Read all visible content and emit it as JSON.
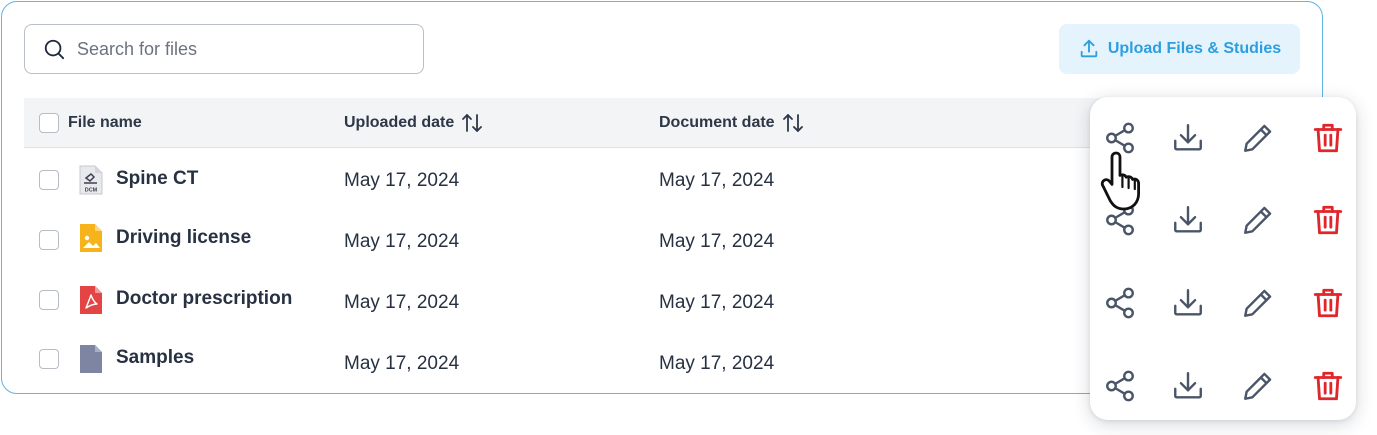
{
  "search": {
    "placeholder": "Search for files",
    "icon": "search-icon"
  },
  "upload": {
    "label": "Upload Files & Studies",
    "icon": "upload-icon"
  },
  "table": {
    "headers": {
      "file_name": "File name",
      "uploaded_date": "Uploaded date",
      "document_date": "Document date"
    },
    "rows": [
      {
        "name": "Spine CT",
        "type": "dcm",
        "uploaded": "May 17, 2024",
        "document": "May 17, 2024",
        "icon_label": "DCM"
      },
      {
        "name": "Driving license",
        "type": "image",
        "uploaded": "May 17, 2024",
        "document": "May 17, 2024"
      },
      {
        "name": "Doctor prescription",
        "type": "pdf",
        "uploaded": "May 17, 2024",
        "document": "May 17, 2024"
      },
      {
        "name": "Samples",
        "type": "folder",
        "uploaded": "May 17, 2024",
        "document": "May 17, 2024"
      }
    ]
  },
  "actions": {
    "icons": [
      "share-icon",
      "download-icon",
      "edit-icon",
      "trash-icon"
    ],
    "colors": {
      "default": "#4a5568",
      "delete": "#e0262b"
    }
  },
  "colors": {
    "accent": "#2d9fe0",
    "accent_bg": "#e5f3fc",
    "card_border": "#5eb6e8",
    "header_bg": "#f3f4f6"
  }
}
